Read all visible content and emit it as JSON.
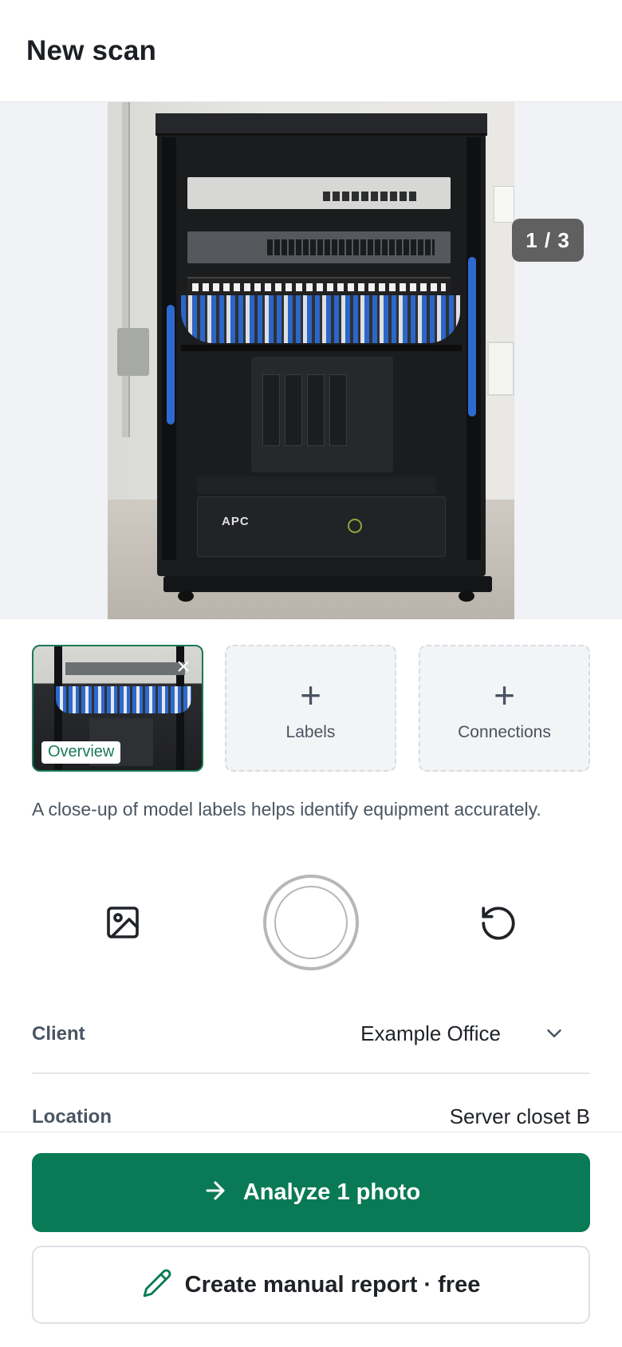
{
  "header": {
    "title": "New scan"
  },
  "preview": {
    "counter": "1 / 3",
    "ups_brand": "APC"
  },
  "slots": [
    {
      "label": "Overview",
      "state": "filled"
    },
    {
      "label": "Labels",
      "state": "empty"
    },
    {
      "label": "Connections",
      "state": "empty"
    }
  ],
  "hint": "A close-up of model labels helps identify equipment accurately.",
  "capture": {
    "gallery_icon": "image-icon",
    "shutter": "shutter-button",
    "reset_icon": "rotate-ccw-icon"
  },
  "form": {
    "client": {
      "label": "Client",
      "value": "Example Office"
    },
    "location": {
      "label": "Location",
      "value": "Server closet B"
    }
  },
  "actions": {
    "analyze_label": "Analyze 1 photo",
    "manual_label": "Create manual report · free"
  },
  "colors": {
    "primary": "#097a55",
    "accent_border": "#1b7a55",
    "muted_text": "#4a5563"
  }
}
